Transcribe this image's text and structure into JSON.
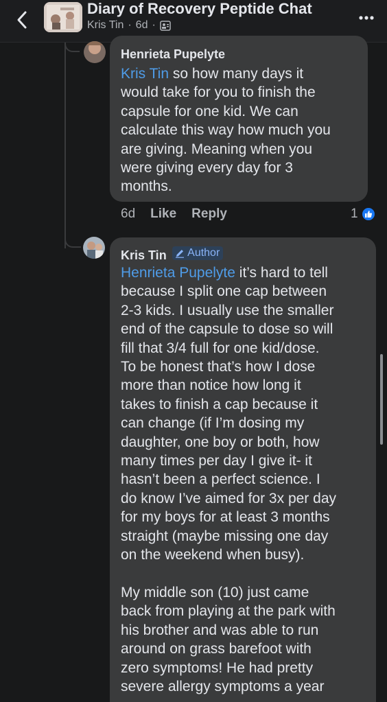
{
  "header": {
    "group_title": "Diary of Recovery Peptide Chat",
    "subtitle_author": "Kris Tin",
    "subtitle_time": "6d",
    "separator": "·",
    "back_icon": "chevron-left-icon",
    "more_icon": "more-dots-icon",
    "members_icon": "members-icon"
  },
  "comments": [
    {
      "author": "Henrieta Pupelyte",
      "mention": "Kris Tin",
      "lines": [
        " so how many days it",
        "would take for you to finish the",
        "capsule for one kid. We can",
        "calculate this way how much you",
        "are giving. Meaning when you",
        "were giving every day for 3",
        "months."
      ],
      "time": "6d",
      "like_label": "Like",
      "reply_label": "Reply",
      "reaction_count": "1"
    },
    {
      "author": "Kris Tin",
      "badge": "Author",
      "mention": "Henrieta Pupelyte",
      "lines": [
        " it’s hard to tell",
        "because I split one cap between",
        "2-3 kids. I usually use the smaller",
        "end of the capsule to dose so will",
        "fill that 3/4 full for one kid/dose.",
        "To be honest that’s how I dose",
        "more than notice how long it",
        "takes to finish a cap because it",
        "can change (if I’m dosing my",
        "daughter, one boy or both, how",
        "many times per day I give it- it",
        "hasn’t been a perfect science. I",
        "do know I’ve aimed for 3x per day",
        "for my boys for at least 3 months",
        "straight (maybe missing one day",
        "on the weekend when busy).",
        "",
        "My middle son (10) just came",
        "back from playing at the park with",
        "his brother and was able to run",
        "around on grass barefoot with",
        "zero symptoms! He had pretty",
        "severe allergy symptoms a year"
      ]
    }
  ],
  "colors": {
    "background": "#18191a",
    "bubble": "#3a3b3c",
    "mention": "#4f9ce8",
    "like_blue": "#1877f2"
  }
}
